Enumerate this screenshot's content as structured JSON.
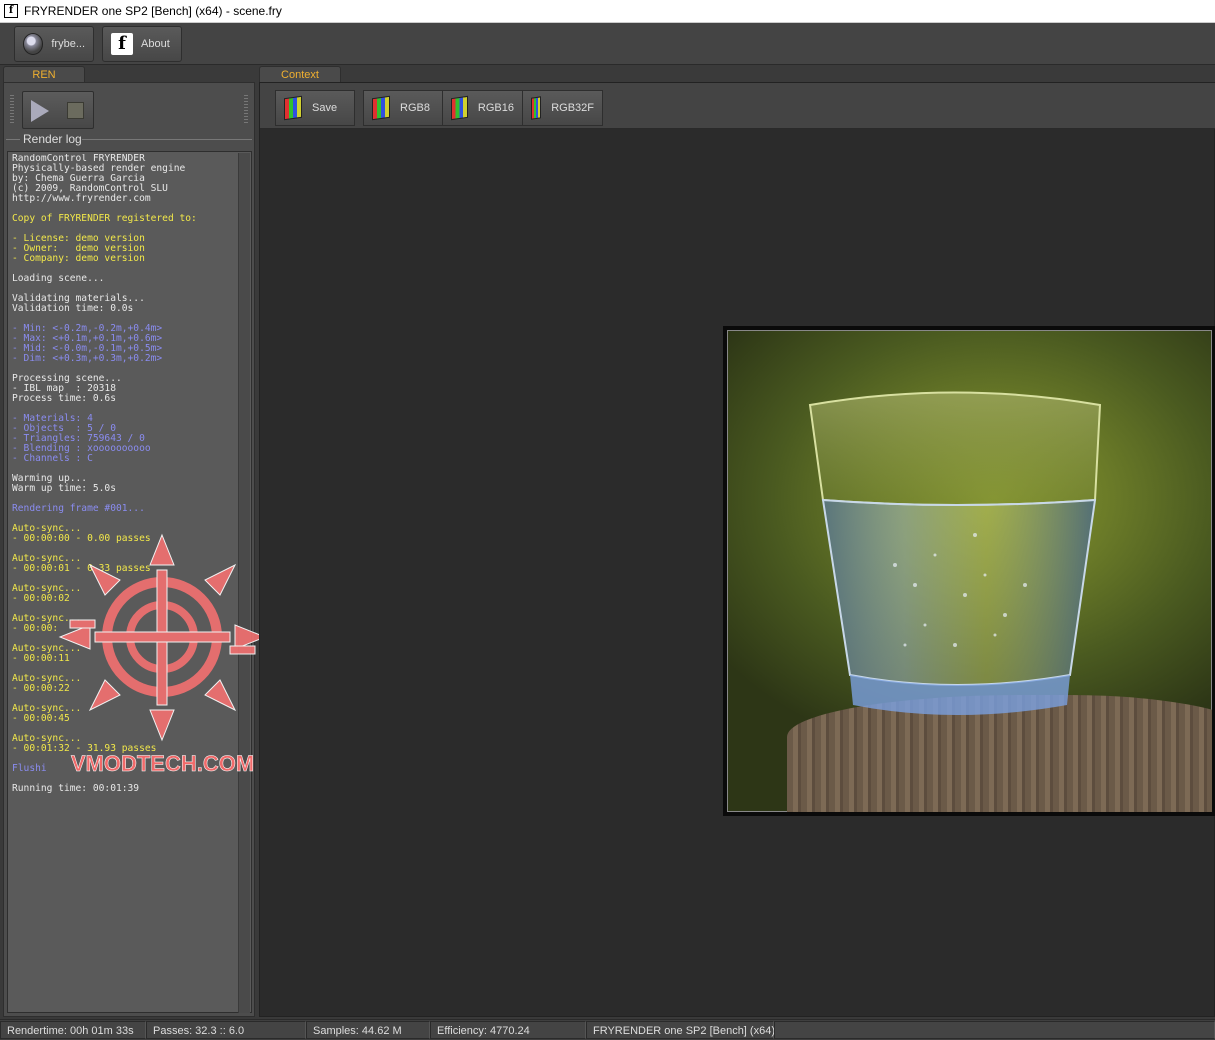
{
  "window": {
    "title": "FRYRENDER one SP2 [Bench] (x64) - scene.fry",
    "icon_letter": "f"
  },
  "toolbar": {
    "frybe_label": "frybe...",
    "about_label": "About"
  },
  "tabs": {
    "ren": "REN",
    "context": "Context"
  },
  "render_log": {
    "title": "Render log",
    "lines": [
      {
        "t": "RandomControl FRYRENDER",
        "c": "w"
      },
      {
        "t": "Physically-based render engine",
        "c": "w"
      },
      {
        "t": "by: Chema Guerra Garcia",
        "c": "w"
      },
      {
        "t": "(c) 2009, RandomControl SLU",
        "c": "w"
      },
      {
        "t": "http://www.fryrender.com",
        "c": "w"
      },
      {
        "t": "",
        "c": "w"
      },
      {
        "t": "Copy of FRYRENDER registered to:",
        "c": "y"
      },
      {
        "t": "",
        "c": "w"
      },
      {
        "t": "- License: demo version",
        "c": "y"
      },
      {
        "t": "- Owner:   demo version",
        "c": "y"
      },
      {
        "t": "- Company: demo version",
        "c": "y"
      },
      {
        "t": "",
        "c": "w"
      },
      {
        "t": "Loading scene...",
        "c": "w"
      },
      {
        "t": "",
        "c": "w"
      },
      {
        "t": "Validating materials...",
        "c": "w"
      },
      {
        "t": "Validation time: 0.0s",
        "c": "w"
      },
      {
        "t": "",
        "c": "w"
      },
      {
        "t": "- Min: <-0.2m,-0.2m,+0.4m>",
        "c": "b"
      },
      {
        "t": "- Max: <+0.1m,+0.1m,+0.6m>",
        "c": "b"
      },
      {
        "t": "- Mid: <-0.0m,-0.1m,+0.5m>",
        "c": "b"
      },
      {
        "t": "- Dim: <+0.3m,+0.3m,+0.2m>",
        "c": "b"
      },
      {
        "t": "",
        "c": "w"
      },
      {
        "t": "Processing scene...",
        "c": "w"
      },
      {
        "t": "- IBL map  : 20318",
        "c": "w"
      },
      {
        "t": "Process time: 0.6s",
        "c": "w"
      },
      {
        "t": "",
        "c": "w"
      },
      {
        "t": "- Materials: 4",
        "c": "b"
      },
      {
        "t": "- Objects  : 5 / 0",
        "c": "b"
      },
      {
        "t": "- Triangles: 759643 / 0",
        "c": "b"
      },
      {
        "t": "- Blending : xoooooooooo",
        "c": "b"
      },
      {
        "t": "- Channels : C",
        "c": "b"
      },
      {
        "t": "",
        "c": "w"
      },
      {
        "t": "Warming up...",
        "c": "w"
      },
      {
        "t": "Warm up time: 5.0s",
        "c": "w"
      },
      {
        "t": "",
        "c": "w"
      },
      {
        "t": "Rendering frame #001...",
        "c": "b"
      },
      {
        "t": "",
        "c": "w"
      },
      {
        "t": "Auto-sync...",
        "c": "y"
      },
      {
        "t": "- 00:00:00 - 0.00 passes",
        "c": "y"
      },
      {
        "t": "",
        "c": "w"
      },
      {
        "t": "Auto-sync...",
        "c": "y"
      },
      {
        "t": "- 00:00:01 - 0.33 passes",
        "c": "y"
      },
      {
        "t": "",
        "c": "w"
      },
      {
        "t": "Auto-sync...",
        "c": "y"
      },
      {
        "t": "- 00:00:02",
        "c": "y"
      },
      {
        "t": "",
        "c": "w"
      },
      {
        "t": "Auto-sync...",
        "c": "y"
      },
      {
        "t": "- 00:00:",
        "c": "y"
      },
      {
        "t": "",
        "c": "w"
      },
      {
        "t": "Auto-sync...",
        "c": "y"
      },
      {
        "t": "- 00:00:11",
        "c": "y"
      },
      {
        "t": "",
        "c": "w"
      },
      {
        "t": "Auto-sync...",
        "c": "y"
      },
      {
        "t": "- 00:00:22",
        "c": "y"
      },
      {
        "t": "",
        "c": "w"
      },
      {
        "t": "Auto-sync...",
        "c": "y"
      },
      {
        "t": "- 00:00:45",
        "c": "y"
      },
      {
        "t": "",
        "c": "w"
      },
      {
        "t": "Auto-sync...",
        "c": "y"
      },
      {
        "t": "- 00:01:32 - 31.93 passes",
        "c": "y"
      },
      {
        "t": "",
        "c": "w"
      },
      {
        "t": "Flushi",
        "c": "b"
      },
      {
        "t": "",
        "c": "w"
      },
      {
        "t": "Running time: 00:01:39",
        "c": "w"
      }
    ]
  },
  "context_toolbar": {
    "save_label": "Save",
    "rgb8_label": "RGB8",
    "rgb16_label": "RGB16",
    "rgb32f_label": "RGB32F"
  },
  "watermark": {
    "text": "VMODTECH.COM"
  },
  "statusbar": {
    "rendertime": "Rendertime:  00h 01m 33s",
    "passes": "Passes:  32.3 :: 6.0",
    "samples": "Samples:  44.62 M",
    "efficiency": "Efficiency:  4770.24",
    "product": "FRYRENDER one SP2 [Bench] (x64)"
  },
  "colors": {
    "tab_accent": "#f0b030",
    "log_yellow": "#f2e84a",
    "log_blue": "#8a8cf0",
    "watermark": "#f06a6a"
  }
}
